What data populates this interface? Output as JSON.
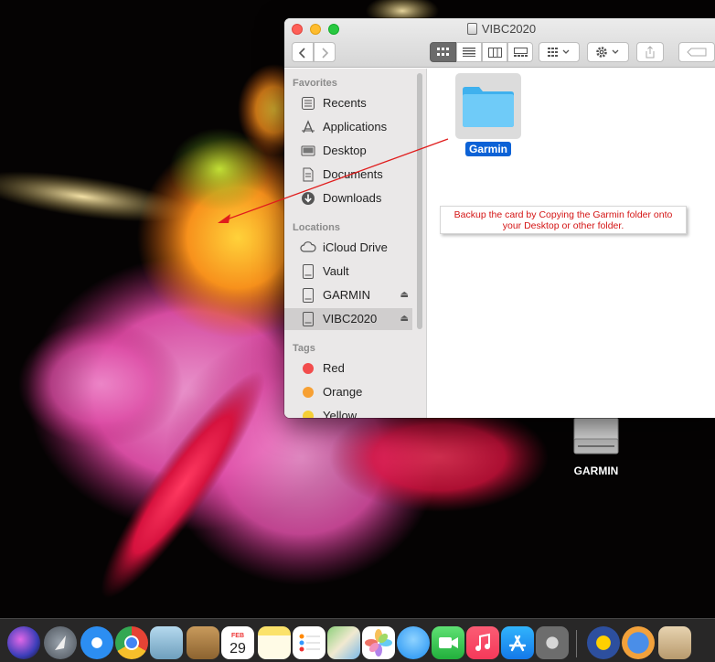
{
  "window": {
    "title": "VIBC2020",
    "toolbar": {
      "back_icon": "chevron-left-icon",
      "forward_icon": "chevron-right-icon",
      "view_modes": [
        "icon-view-icon",
        "list-view-icon",
        "column-view-icon",
        "gallery-view-icon"
      ],
      "active_view": "icon-view-icon",
      "group_icon": "group-grid-icon",
      "action_icon": "gear-icon",
      "share_icon": "share-icon",
      "tags_icon": "tag-icon"
    }
  },
  "sidebar": {
    "favorites_header": "Favorites",
    "favorites": [
      {
        "label": "Recents",
        "icon": "clock-icon"
      },
      {
        "label": "Applications",
        "icon": "applications-icon"
      },
      {
        "label": "Desktop",
        "icon": "desktop-icon"
      },
      {
        "label": "Documents",
        "icon": "document-icon"
      },
      {
        "label": "Downloads",
        "icon": "download-icon"
      }
    ],
    "locations_header": "Locations",
    "locations": [
      {
        "label": "iCloud Drive",
        "icon": "cloud-icon"
      },
      {
        "label": "Vault",
        "icon": "drive-icon"
      },
      {
        "label": "GARMIN",
        "icon": "drive-icon",
        "eject": "⏏"
      },
      {
        "label": "VIBC2020",
        "icon": "drive-icon",
        "eject": "⏏",
        "selected": true
      }
    ],
    "tags_header": "Tags",
    "tags": [
      {
        "label": "Red",
        "color": "#f24c4c"
      },
      {
        "label": "Orange",
        "color": "#f7a033"
      },
      {
        "label": "Yellow",
        "color": "#f5cf35"
      }
    ]
  },
  "content": {
    "items": [
      {
        "label": "Garmin",
        "icon": "folder-icon",
        "selected": true
      }
    ],
    "annotation": {
      "line1": "Backup the card by Copying the Garmin folder onto",
      "line2": "your Desktop or other folder.",
      "color": "#d41515"
    }
  },
  "desktop": {
    "items": [
      {
        "label": "GARMIN",
        "icon": "external-drive-icon"
      }
    ]
  },
  "dock": {
    "apps": [
      {
        "name": "siri-icon"
      },
      {
        "name": "launchpad-icon"
      },
      {
        "name": "safari-icon"
      },
      {
        "name": "chrome-icon"
      },
      {
        "name": "preview-icon"
      },
      {
        "name": "contacts-icon"
      },
      {
        "name": "calendar-icon",
        "month": "FEB",
        "day": "29"
      },
      {
        "name": "notes-icon"
      },
      {
        "name": "reminders-icon"
      },
      {
        "name": "maps-icon"
      },
      {
        "name": "photos-icon"
      },
      {
        "name": "messages-icon"
      },
      {
        "name": "facetime-icon"
      },
      {
        "name": "music-icon"
      },
      {
        "name": "app-store-icon"
      },
      {
        "name": "system-preferences-icon"
      },
      {
        "name": "basecamp-icon"
      },
      {
        "name": "garmin-express-icon"
      },
      {
        "name": "map-install-icon"
      }
    ]
  }
}
